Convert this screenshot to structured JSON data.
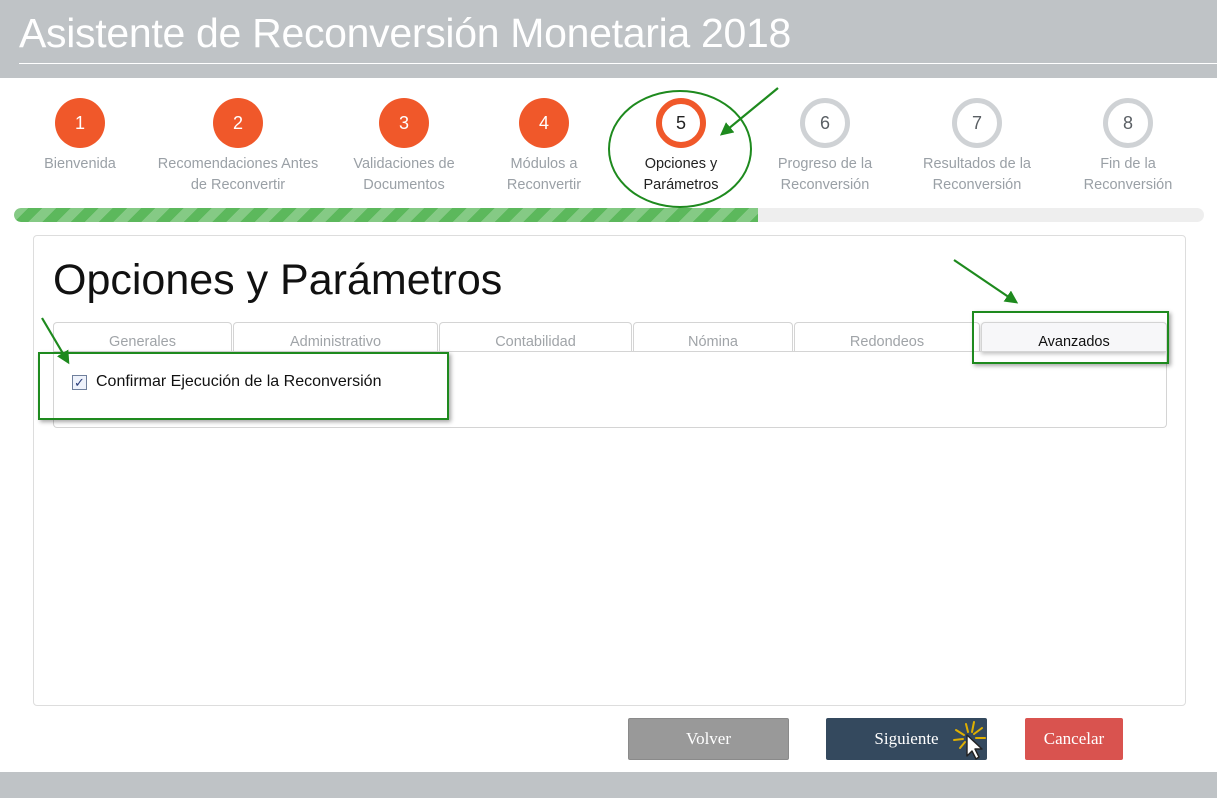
{
  "header": {
    "title": "Asistente de Reconversión Monetaria 2018"
  },
  "steps": [
    {
      "number": "1",
      "label": "Bienvenida",
      "state": "done"
    },
    {
      "number": "2",
      "label": "Recomendaciones Antes\nde Reconvertir",
      "state": "done"
    },
    {
      "number": "3",
      "label": "Validaciones de\nDocumentos",
      "state": "done"
    },
    {
      "number": "4",
      "label": "Módulos a\nReconvertir",
      "state": "done"
    },
    {
      "number": "5",
      "label": "Opciones y\nParámetros",
      "state": "current"
    },
    {
      "number": "6",
      "label": "Progreso de la\nReconversión",
      "state": "todo"
    },
    {
      "number": "7",
      "label": "Resultados de la\nReconversión",
      "state": "todo"
    },
    {
      "number": "8",
      "label": "Fin de la\nReconversión",
      "state": "todo"
    }
  ],
  "progress": {
    "fraction": 0.625,
    "color": "#5cb85c"
  },
  "panel": {
    "title": "Opciones y Parámetros",
    "tabs": [
      {
        "label": "Generales"
      },
      {
        "label": "Administrativo"
      },
      {
        "label": "Contabilidad"
      },
      {
        "label": "Nómina"
      },
      {
        "label": "Redondeos"
      },
      {
        "label": "Avanzados",
        "active": true
      }
    ],
    "confirm_checkbox": {
      "label": "Confirmar Ejecución de la Reconversión",
      "checked": true,
      "mark": "✓"
    }
  },
  "buttons": {
    "back_label": "Volver",
    "next_label": "Siguiente",
    "cancel_label": "Cancelar"
  },
  "colors": {
    "accent_orange": "#f0582a",
    "next_button": "#34495e",
    "cancel_button": "#d9534f",
    "back_button": "#999999",
    "annotation_green": "#1e8a1e"
  }
}
